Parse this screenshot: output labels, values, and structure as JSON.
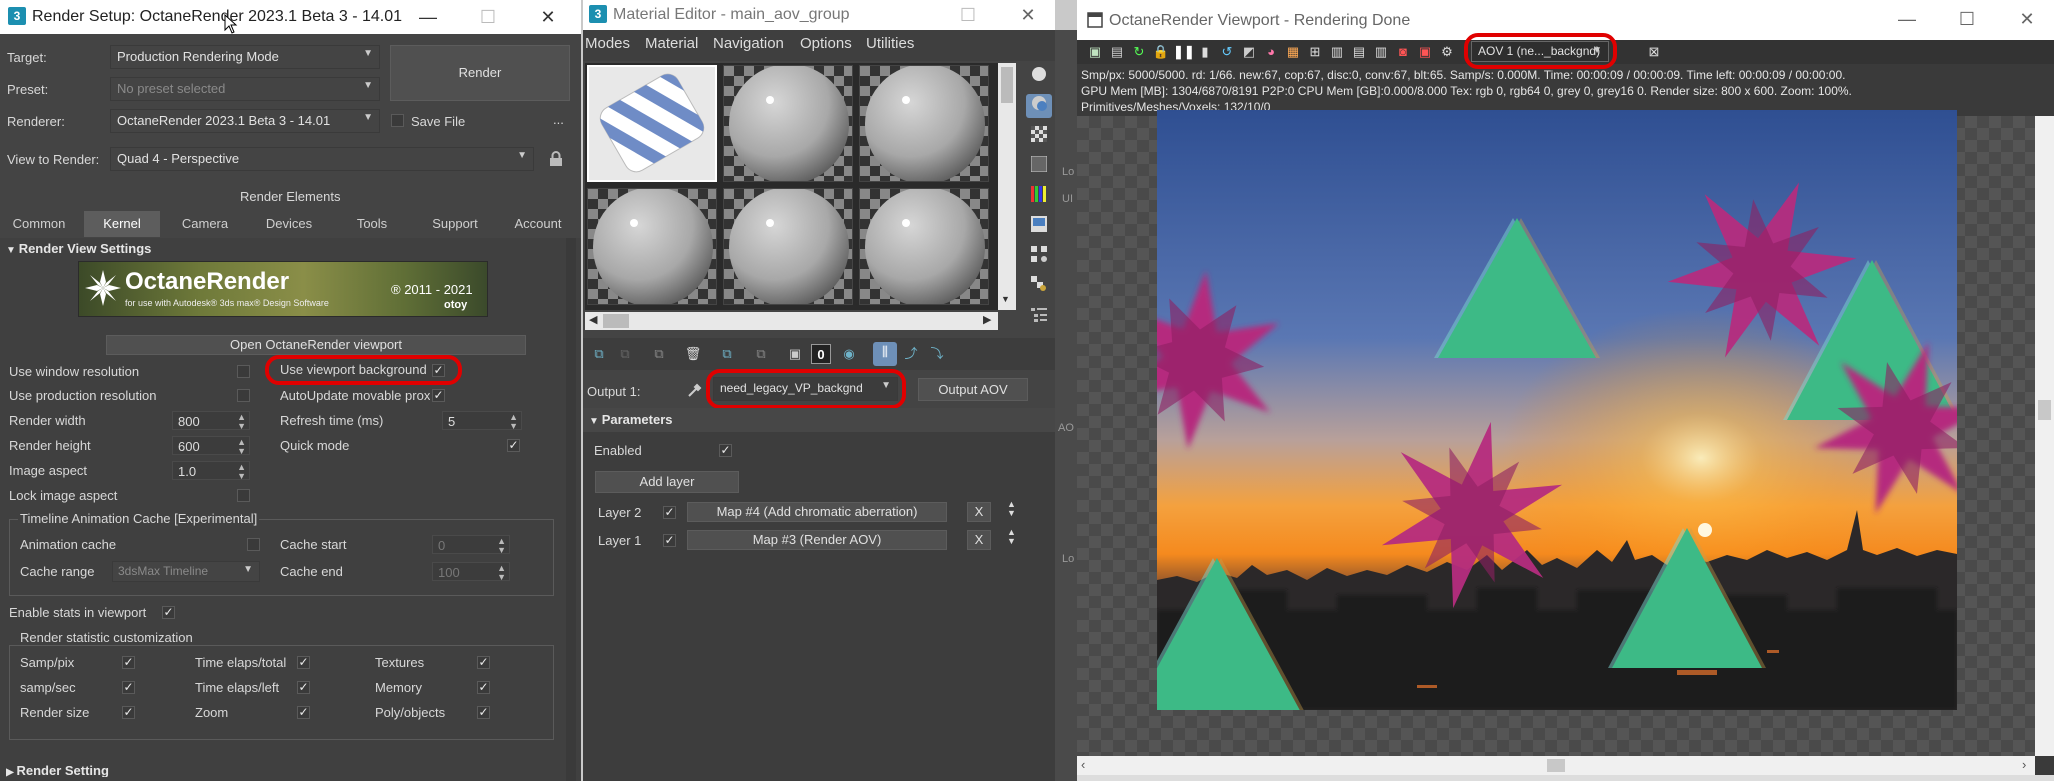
{
  "render_setup": {
    "title": "Render Setup: OctaneRender 2023.1 Beta 3 - 14.01",
    "target_label": "Target:",
    "target_value": "Production Rendering Mode",
    "preset_label": "Preset:",
    "preset_value": "No preset selected",
    "renderer_label": "Renderer:",
    "renderer_value": "OctaneRender 2023.1 Beta 3 - 14.01",
    "save_file_label": "Save File",
    "more_label": "...",
    "view_label": "View to Render:",
    "view_value": "Quad 4 - Perspective",
    "render_button": "Render",
    "render_elements": "Render Elements",
    "tabs": [
      "Common",
      "Kernel",
      "Camera",
      "Devices",
      "Tools",
      "Support",
      "Account"
    ],
    "section_title": "Render View Settings",
    "banner_title": "OctaneRender",
    "banner_sub": "for use with Autodesk® 3ds max® Design Software",
    "banner_copy": "® 2011 - 2021",
    "banner_brand": "otoy",
    "open_viewport_button": "Open OctaneRender viewport",
    "use_window_res": "Use window resolution",
    "use_viewport_bg": "Use viewport background",
    "use_production_res": "Use production resolution",
    "autoupdate": "AutoUpdate movable prox",
    "render_width_label": "Render width",
    "render_width": "800",
    "refresh_label": "Refresh time (ms)",
    "refresh_value": "5",
    "render_height_label": "Render height",
    "render_height": "600",
    "quick_mode": "Quick mode",
    "image_aspect_label": "Image aspect",
    "image_aspect": "1.0",
    "lock_aspect": "Lock image aspect",
    "timeline_group": "Timeline Animation Cache [Experimental]",
    "anim_cache": "Animation cache",
    "cache_start_label": "Cache start",
    "cache_start": "0",
    "cache_range_label": "Cache range",
    "cache_range": "3dsMax Timeline",
    "cache_end_label": "Cache end",
    "cache_end": "100",
    "enable_stats": "Enable stats in viewport",
    "stat_group": "Render statistic customization",
    "stats": [
      "Samp/pix",
      "Time elaps/total",
      "Textures",
      "samp/sec",
      "Time elaps/left",
      "Memory",
      "Render size",
      "Zoom",
      "Poly/objects"
    ],
    "bottom_section": "Render Setting"
  },
  "material_editor": {
    "title": "Material Editor - main_aov_group",
    "menu": [
      "Modes",
      "Material",
      "Navigation",
      "Options",
      "Utilities"
    ],
    "output_label": "Output 1:",
    "output_value": "need_legacy_VP_backgnd",
    "output_aov_button": "Output AOV",
    "params_title": "Parameters",
    "enabled_label": "Enabled",
    "add_layer": "Add layer",
    "layers": [
      {
        "label": "Layer 2",
        "map": "Map #4 (Add chromatic aberration)",
        "x": "X"
      },
      {
        "label": "Layer 1",
        "map": "Map #3 (Render AOV)",
        "x": "X"
      }
    ],
    "zero_icon": "0"
  },
  "viewport": {
    "title": "OctaneRender Viewport - Rendering Done",
    "aov_select": "AOV 1 (ne..._backgnd)",
    "info_line1": "Smp/px: 5000/5000.   rd: 1/66.   new:67, cop:67, disc:0, conv:67, blt:65.   Samp/s: 0.000M.   Time: 00:00:09 / 00:00:09.   Time left: 00:00:09 / 00:00:00.",
    "info_line2": "GPU Mem [MB]: 1304/6870/8191 P2P:0   CPU Mem [GB]:0.000/8.000   Tex: rgb 0, rgb64 0, grey 0, grey16 0.   Render size: 800 x 600.   Zoom: 100%.",
    "info_line3": "Primitives/Meshes/Voxels: 132/10/0"
  },
  "gaps": {
    "g1": "Lo",
    "g2": "UI",
    "g3": "AO",
    "g4": "Lo"
  },
  "colors": {
    "panel_bg": "#444444",
    "highlight": "#e00000",
    "tri_green": "#3dba86",
    "star_magenta": "#b52c7e"
  }
}
